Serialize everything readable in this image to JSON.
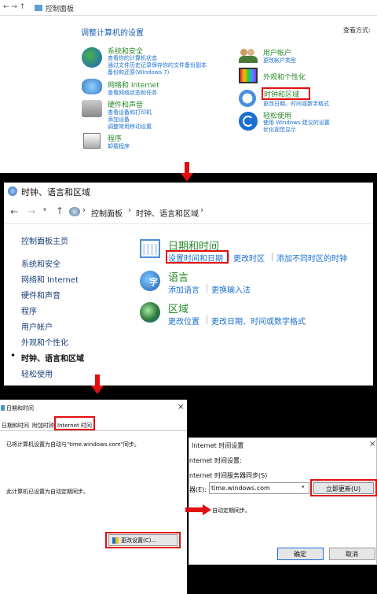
{
  "p1": {
    "breadcrumb": "控制面板",
    "title": "调整计算机的设置",
    "view_by": "查看方式:",
    "left": [
      {
        "title": "系统和安全",
        "links": [
          "查看你的计算机状态",
          "通过文件历史记录保存你的文件备份副本",
          "备份和还原(Windows 7)"
        ]
      },
      {
        "title": "网络和 Internet",
        "links": [
          "查看网络状态和任务"
        ]
      },
      {
        "title": "硬件和声音",
        "links": [
          "查看设备和打印机",
          "添加设备",
          "调整常用移动设置"
        ]
      },
      {
        "title": "程序",
        "links": [
          "卸载程序"
        ]
      }
    ],
    "right": [
      {
        "title": "用户帐户",
        "links": [
          "更改帐户类型"
        ]
      },
      {
        "title": "外观和个性化",
        "links": []
      },
      {
        "title": "时钟和区域",
        "links": [
          "更改日期、时间或数字格式"
        ]
      },
      {
        "title": "轻松使用",
        "links": [
          "使用 Windows 建议的设置",
          "优化视觉显示"
        ]
      }
    ]
  },
  "p2": {
    "window_title": "时钟、语言和区域",
    "path": [
      "控制面板",
      "时钟、语言和区域"
    ],
    "sidebar": [
      "控制面板主页",
      "系统和安全",
      "网络和 Internet",
      "硬件和声音",
      "程序",
      "用户帐户",
      "外观和个性化",
      "时钟、语言和区域",
      "轻松使用"
    ],
    "sections": [
      {
        "title": "日期和时间",
        "links": [
          "设置时间和日期",
          "更改时区",
          "添加不同时区的时钟"
        ]
      },
      {
        "title": "语言",
        "links": [
          "添加语言",
          "更换输入法"
        ]
      },
      {
        "title": "区域",
        "links": [
          "更改位置",
          "更改日期、时间或数字格式"
        ]
      }
    ]
  },
  "p3": {
    "window_title": "日期和时间",
    "tabs": [
      "日期和时间",
      "附加时钟",
      "Internet 时间"
    ],
    "text1": "已将计算机设置为自动与\"time.windows.com\"同步。",
    "text2": "此计算机已设置为自动定期同步。",
    "change_btn": "更改设置(C)..."
  },
  "p4": {
    "window_title": "Internet 时间设置",
    "label1": "nternet 时间设置:",
    "label2": "nternet 时间服务器同步(S)",
    "server_label": "器(E):",
    "server_value": "time.windows.com",
    "update_btn": "立即更新(U)",
    "auto_text": "自动定期同步。",
    "ok": "确定",
    "cancel": "取消"
  },
  "colors": {
    "accent": "#1a5fb4",
    "green": "#2a8a2a",
    "highlight": "#e01010"
  }
}
